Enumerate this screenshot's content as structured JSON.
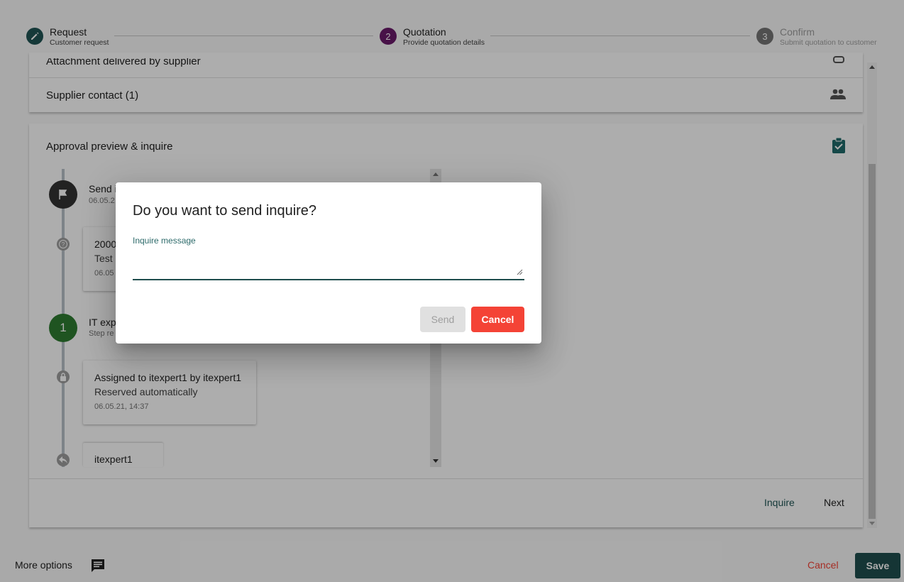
{
  "stepper": {
    "steps": [
      {
        "number": "✎",
        "title": "Request",
        "subtitle": "Customer request",
        "color": "#1f5454"
      },
      {
        "number": "2",
        "title": "Quotation",
        "subtitle": "Provide quotation details",
        "color": "#6a1b6a"
      },
      {
        "number": "3",
        "title": "Confirm",
        "subtitle": "Submit quotation to customer",
        "color": "#757575"
      }
    ]
  },
  "sections": {
    "attachment_label": "Attachment delivered by supplier",
    "supplier_contact_label": "Supplier contact (1)",
    "approval_label": "Approval preview & inquire"
  },
  "timeline": {
    "send_title": "Send i",
    "send_date": "06.05.2",
    "card1_line1": "2000",
    "card1_line2": "Test",
    "card1_date": "06.05",
    "step_number": "1",
    "step_title": "IT exp",
    "step_sub": "Step re",
    "card2_line1": "Assigned to itexpert1 by itexpert1",
    "card2_line2": "Reserved automatically",
    "card2_date": "06.05.21, 14:37",
    "card3_line1": "itexpert1"
  },
  "panel_actions": {
    "inquire": "Inquire",
    "next": "Next"
  },
  "bottom_bar": {
    "more_options": "More options",
    "cancel": "Cancel",
    "save": "Save"
  },
  "dialog": {
    "title": "Do you want to send inquire?",
    "field_label": "Inquire message",
    "field_value": "",
    "send_label": "Send",
    "cancel_label": "Cancel"
  },
  "colors": {
    "primary": "#1f4e4e",
    "accent": "#6a1b6a",
    "danger": "#f44336",
    "success": "#2e7d32"
  }
}
